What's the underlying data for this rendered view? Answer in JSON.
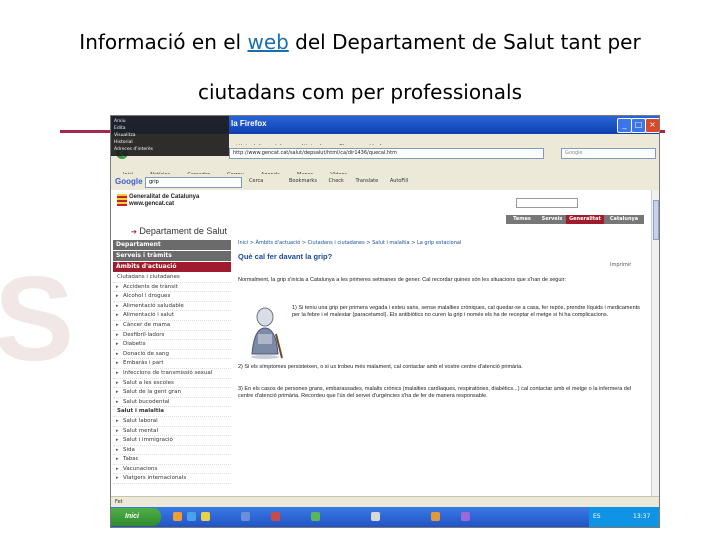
{
  "slide": {
    "title_line1_before": "Informació en el ",
    "title_link": "web",
    "title_line1_after": " del Departament de Salut tant per",
    "title_line2": "ciutadans com per professionals"
  },
  "browser": {
    "title_fragment": "la Firefox",
    "menu": [
      "Arxiu",
      "Edita",
      "Visualitza",
      "Historial",
      "Adreces d'interès",
      "Eines",
      "Ajuda"
    ],
    "menu_visible": [
      "Historial",
      "Adreces d'interès",
      "Eines",
      "Ajuda"
    ],
    "url": "http://www.gencat.cat/salut/depsalut/html/ca/dir1436/quecal.htm",
    "search_placeholder": "Google",
    "google_logo": "Google",
    "google_query": "grip",
    "google_search_btn": "Cerca",
    "google_toolbar_items": [
      "Bookmarks",
      "Check",
      "Translate",
      "AutoFill"
    ],
    "bookmarks": [
      "Inici",
      "Notícies",
      "Cercador",
      "Correu",
      "Agenda",
      "Mapes",
      "Vídeos"
    ],
    "status": "Fet"
  },
  "site": {
    "org_name": "Generalitat de Catalunya",
    "org_url": "www.gencat.cat",
    "topnav": [
      "Temes",
      "Serveis",
      "Generalitat",
      "Catalunya"
    ],
    "dept_title": "Departament de Salut",
    "sidebar_blocks": [
      "Departament",
      "Serveis i tràmits",
      "Àmbits d'actuació"
    ],
    "sidebar_items": [
      "Ciutadans i ciutadanes",
      "Accidents de trànsit",
      "Alcohol i drogues",
      "Alimentació saludable",
      "Alimentació i salut",
      "Càncer de mama",
      "Desfibril·ladors",
      "Diabetis",
      "Donació de sang",
      "Embaràs i part",
      "Infeccions de transmissió sexual",
      "Salut a les escoles",
      "Salut de la gent gran",
      "Salut bucodental",
      "Salut i malaltia",
      "Salut laboral",
      "Salut mental",
      "Salut i immigració",
      "Sida",
      "Tabac",
      "Vacunacions",
      "Viatgers internacionals"
    ],
    "breadcrumb": "Inici > Àmbits d'actuació > Ciutadans i ciutadanes > Salut i malaltia > La grip estacional",
    "heading": "Què cal fer davant la grip?",
    "print_label": "Imprimir",
    "para1": "Normalment, la grip s'inicia a Catalunya a les primeres setmanes de gener. Cal recordar quines són les situacions que s'han de seguir:",
    "para2": "1) Si teniu una grip per primera vegada i esteu sans, sense malalties cròniques, cal quedar-se a casa, fer repòs, prendre líquids i medicaments per la febre i el malestar (paracetamol). Els antibiòtics no curen la grip i només els ha de receptar el metge si hi ha complicacions.",
    "para3": "2) Si els símptomes persisteixen, o si us trobeu més malament, cal contactar amb el vostre centre d'atenció primària.",
    "para4": "3) En els casos de persones grans, embarassades, malalts crònics (malalties cardíaques, respiratòries, diabètics...) cal contactar amb el metge o la infermera del centre d'atenció primària. Recordeu que l'ús del servei d'urgències s'ha de fer de manera responsable."
  },
  "taskbar": {
    "start_label": "Inici",
    "clock": "13:37",
    "lang": "ES"
  },
  "colors": {
    "accent_rule": "#a3294a",
    "link_blue": "#1a6fb0",
    "sidebar_red": "#a01c2c",
    "xp_blue": "#2b66d9"
  }
}
